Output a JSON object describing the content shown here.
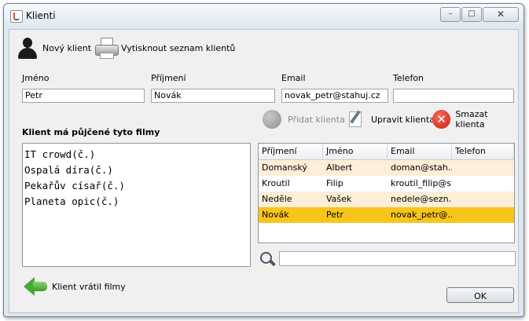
{
  "window": {
    "title": "Klienti",
    "minimize": "–",
    "maximize": "□",
    "close": "✕"
  },
  "toolbar": {
    "new_client": "Nový klient",
    "print_list": "Vytisknout seznam klientů"
  },
  "form": {
    "first_name_label": "Jméno",
    "first_name_value": "Petr",
    "last_name_label": "Příjmení",
    "last_name_value": "Novák",
    "email_label": "Email",
    "email_value": "novak_petr@stahuj.cz",
    "phone_label": "Telefon",
    "phone_value": ""
  },
  "actions": {
    "add": "Přidat klienta",
    "edit": "Upravit klienta",
    "delete": "Smazat klienta"
  },
  "films": {
    "heading": "Klient má půjčené tyto filmy",
    "items": [
      "IT crowd(č.)",
      "Ospalá díra(č.)",
      "Pekařův císař(č.)",
      "Planeta opic(č.)"
    ]
  },
  "table": {
    "columns": [
      "Příjmení",
      "Jméno",
      "Email",
      "Telefon"
    ],
    "rows": [
      {
        "last": "Domanský",
        "first": "Albert",
        "email": "doman@stah...",
        "phone": "",
        "bg": "#fdeed8"
      },
      {
        "last": "Kroutil",
        "first": "Filip",
        "email": "kroutil_filip@s...",
        "phone": "",
        "bg": "#ffffff"
      },
      {
        "last": "Neděle",
        "first": "Vašek",
        "email": "nedele@sezn...",
        "phone": "",
        "bg": "#fdeed8"
      },
      {
        "last": "Novák",
        "first": "Petr",
        "email": "novak_petr@...",
        "phone": "",
        "bg": "#f7c51b"
      }
    ]
  },
  "search": {
    "value": ""
  },
  "return_films": "Klient vrátil filmy",
  "ok": "OK"
}
